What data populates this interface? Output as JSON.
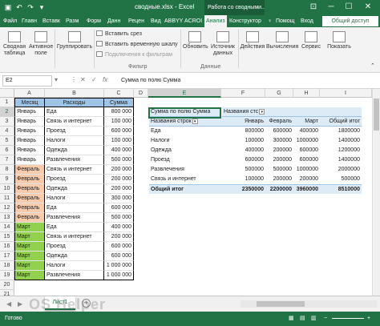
{
  "window": {
    "doc_title": "сводные.xlsx - Excel",
    "context_title": "Работа со сводными...",
    "min": "─",
    "max": "☐",
    "close": "✕"
  },
  "tabs": [
    "Файл",
    "Главн",
    "Вставк",
    "Разм",
    "Форм",
    "Данн",
    "Рецен",
    "Вид",
    "ABBYY",
    "ACROI",
    "Анализ",
    "Конструктор"
  ],
  "tabs_right": {
    "help": "Помощ",
    "user": "Вход"
  },
  "share": "Общий доступ",
  "ribbon": {
    "pivot_table": "Сводная таблица",
    "active_field": "Активное поле",
    "group": "Группировать",
    "insert_slicer": "Вставить срез",
    "insert_timeline": "Вставить временную шкалу",
    "filter_connections": "Подключения к фильтрам",
    "filter_group": "Фильтр",
    "refresh": "Обновить",
    "change_source": "Источник данных",
    "data_group": "Данные",
    "actions": "Действия",
    "calculations": "Вычисления",
    "tools": "Сервис",
    "show": "Показать"
  },
  "formula_bar": {
    "name_box": "E2",
    "value": "Сумма по полю Сумма",
    "fx": "fx"
  },
  "columns": [
    "A",
    "B",
    "C",
    "D",
    "E",
    "F",
    "G",
    "H",
    "I"
  ],
  "source_table": {
    "headers": [
      "Месяц",
      "Расходы",
      "Сумма"
    ],
    "rows": [
      [
        "Январь",
        "Еда",
        "800 000"
      ],
      [
        "Январь",
        "Связь и интернет",
        "100 000"
      ],
      [
        "Январь",
        "Проезд",
        "600 000"
      ],
      [
        "Январь",
        "Налоги",
        "100 000"
      ],
      [
        "Январь",
        "Одежда",
        "400 000"
      ],
      [
        "Январь",
        "Развлечения",
        "500 000"
      ],
      [
        "Февраль",
        "Связь и интернет",
        "200 000"
      ],
      [
        "Февраль",
        "Проезд",
        "200 000"
      ],
      [
        "Февраль",
        "Одежда",
        "200 000"
      ],
      [
        "Февраль",
        "Налоги",
        "300 000"
      ],
      [
        "Февраль",
        "Еда",
        "600 000"
      ],
      [
        "Февраль",
        "Развлечения",
        "500 000"
      ],
      [
        "Март",
        "Еда",
        "400 000"
      ],
      [
        "Март",
        "Связь и интернет",
        "200 000"
      ],
      [
        "Март",
        "Проезд",
        "600 000"
      ],
      [
        "Март",
        "Одежда",
        "600 000"
      ],
      [
        "Март",
        "Налоги",
        "1 000 000"
      ],
      [
        "Март",
        "Развлечения",
        "1 000 000"
      ]
    ]
  },
  "pivot": {
    "value_field": "Сумма по полю Сумма",
    "col_label": "Названия стс",
    "row_label": "Названия строк",
    "headers": [
      "Январь",
      "Февраль",
      "Март",
      "Общий итог"
    ],
    "rows": [
      [
        "Еда",
        "800000",
        "600000",
        "400000",
        "1800000"
      ],
      [
        "Налоги",
        "100000",
        "300000",
        "1000000",
        "1400000"
      ],
      [
        "Одежда",
        "400000",
        "200000",
        "600000",
        "1200000"
      ],
      [
        "Проезд",
        "600000",
        "200000",
        "600000",
        "1400000"
      ],
      [
        "Развлечения",
        "500000",
        "500000",
        "1000000",
        "2000000"
      ],
      [
        "Связь и интернет",
        "100000",
        "200000",
        "200000",
        "500000"
      ]
    ],
    "total": [
      "Общий итог",
      "2350000",
      "2200000",
      "3960000",
      "8510000"
    ]
  },
  "sheet": {
    "name": "Лист1",
    "add": "+"
  },
  "status": {
    "ready": "Готово"
  },
  "colors": {
    "excel_green": "#217346",
    "header_blue": "#9dc3e6",
    "feb": "#f8cbad",
    "mar": "#92d050"
  },
  "watermark": "OS Helper"
}
